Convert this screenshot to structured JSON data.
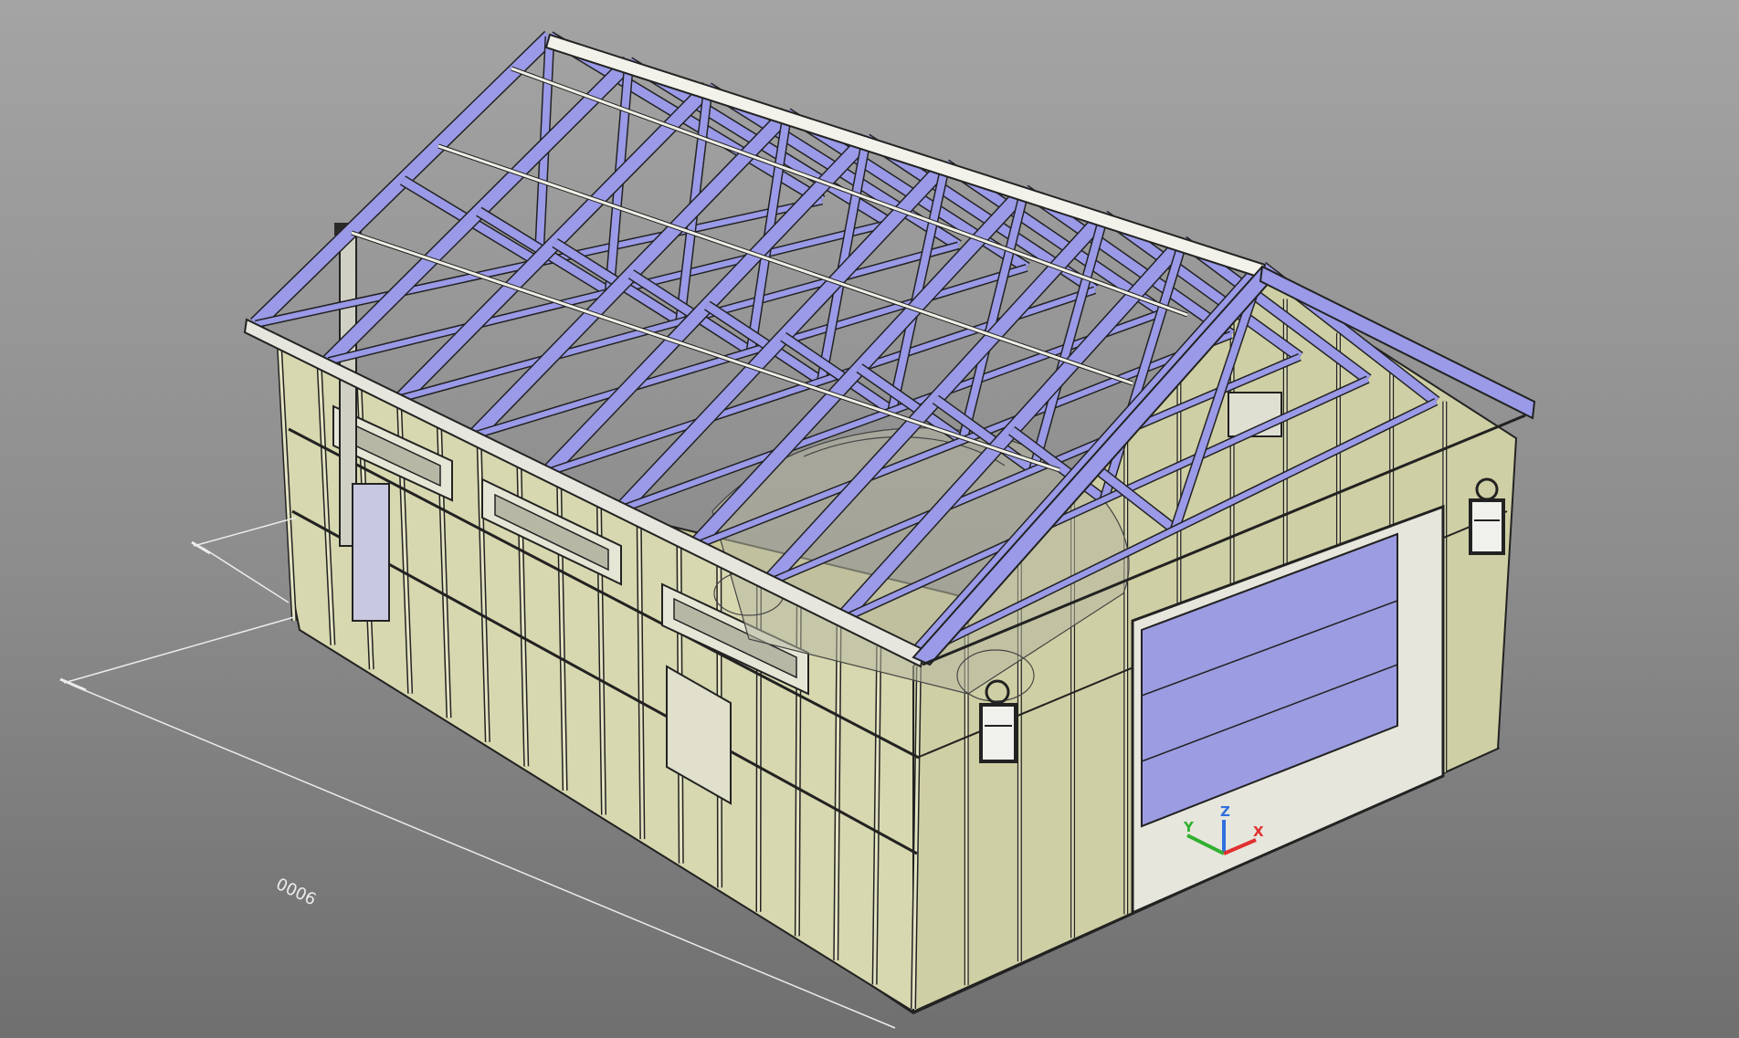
{
  "viewport": {
    "background_top": "#a4a4a4",
    "background_bottom": "#6f6f6f",
    "visual_style": "shaded with edges"
  },
  "model": {
    "wall_color": "#d8d8b0",
    "floor_color": "#c9c99a",
    "truss_color": "#9a9ae8",
    "garage_door_color": "#9c9ce2",
    "edge_color": "#222222"
  },
  "dimension": {
    "value_text": "9000",
    "line_color": "#ececec"
  },
  "ucs_icon": {
    "x_label": "X",
    "y_label": "Y",
    "z_label": "Z",
    "x_color": "#e03030",
    "y_color": "#30b030",
    "z_color": "#3070e0"
  }
}
